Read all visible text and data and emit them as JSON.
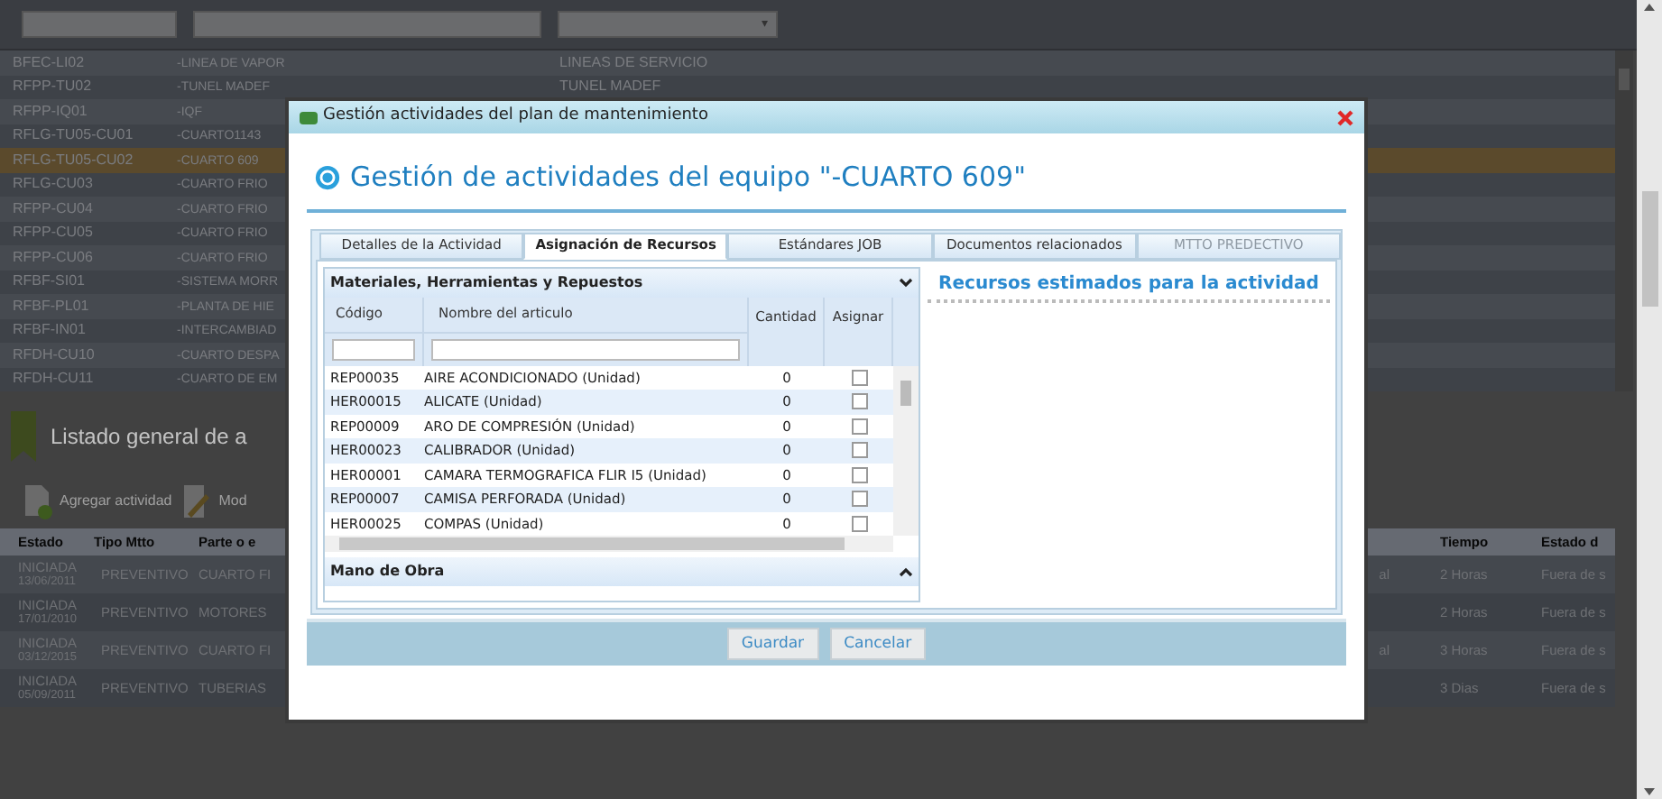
{
  "equipment_list": {
    "type_filter_caret": "▾",
    "rows": [
      {
        "code": "BFEC-LI02",
        "name": "-LINEA DE VAPOR",
        "type": "LINEAS DE SERVICIO",
        "selected": false
      },
      {
        "code": "RFPP-TU02",
        "name": "-TUNEL MADEF",
        "type": "TUNEL MADEF",
        "selected": false
      },
      {
        "code": "RFPP-IQ01",
        "name": "-IQF",
        "selected": false
      },
      {
        "code": "RFLG-TU05-CU01",
        "name": "-CUARTO1143",
        "selected": false
      },
      {
        "code": "RFLG-TU05-CU02",
        "name": "-CUARTO 609",
        "selected": true
      },
      {
        "code": "RFLG-CU03",
        "name": "-CUARTO FRIO",
        "selected": false
      },
      {
        "code": "RFPP-CU04",
        "name": "-CUARTO FRIO",
        "selected": false
      },
      {
        "code": "RFPP-CU05",
        "name": "-CUARTO FRIO",
        "selected": false
      },
      {
        "code": "RFPP-CU06",
        "name": "-CUARTO FRIO",
        "selected": false
      },
      {
        "code": "RFBF-SI01",
        "name": "-SISTEMA MORR",
        "selected": false
      },
      {
        "code": "RFBF-PL01",
        "name": "-PLANTA DE HIE",
        "selected": false
      },
      {
        "code": "RFBF-IN01",
        "name": "-INTERCAMBIAD",
        "selected": false
      },
      {
        "code": "RFDH-CU10",
        "name": "-CUARTO DESPA",
        "selected": false
      },
      {
        "code": "RFDH-CU11",
        "name": "-CUARTO DE EM",
        "selected": false
      }
    ]
  },
  "activities": {
    "title": "Listado general de a",
    "toolbar": [
      "Agregar actividad",
      "Mod"
    ],
    "columns_left": [
      "Estado",
      "Tipo Mtto",
      "Parte o e"
    ],
    "columns_right": [
      "Tiempo",
      "Estado d"
    ],
    "rows": [
      {
        "status": "INICIADA",
        "date": "13/06/2011",
        "type": "PREVENTIVO",
        "part": "CUARTO FI",
        "fragment": "al",
        "time": "2 Horas",
        "state": "Fuera de s"
      },
      {
        "status": "INICIADA",
        "date": "17/01/2010",
        "type": "PREVENTIVO",
        "part": "MOTORES",
        "time": "2 Horas",
        "state": "Fuera de s"
      },
      {
        "status": "INICIADA",
        "date": "03/12/2015",
        "type": "PREVENTIVO",
        "part": "CUARTO FI",
        "fragment": "al",
        "time": "3 Horas",
        "state": "Fuera de s"
      },
      {
        "status": "INICIADA",
        "date": "05/09/2011",
        "type": "PREVENTIVO",
        "part": "TUBERIAS",
        "time": "3 Dias",
        "state": "Fuera de s"
      }
    ]
  },
  "dialog": {
    "title": "Gestión actividades del plan de mantenimiento",
    "heading": "Gestión de actividades del equipo \"-CUARTO 609\"",
    "tabs": [
      {
        "label": "Detalles de la Actividad",
        "selected": false,
        "disabled": false
      },
      {
        "label": "Asignación de Recursos",
        "selected": true,
        "disabled": false
      },
      {
        "label": "Estándares JOB",
        "selected": false,
        "disabled": false
      },
      {
        "label": "Documentos relacionados",
        "selected": false,
        "disabled": false
      },
      {
        "label": "MTTO PREDECTIVO",
        "selected": false,
        "disabled": true
      }
    ],
    "sections": [
      {
        "title": "Materiales, Herramientas y Repuestos",
        "expanded": true
      },
      {
        "title": "Mano de Obra",
        "expanded": false
      }
    ],
    "grid": {
      "columns": [
        "Código",
        "Nombre del articulo",
        "Cantidad",
        "Asignar"
      ],
      "rows": [
        {
          "code": "REP00035",
          "name": "AIRE ACONDICIONADO (Unidad)",
          "qty": "0",
          "checked": false
        },
        {
          "code": "HER00015",
          "name": "ALICATE (Unidad)",
          "qty": "0",
          "checked": false
        },
        {
          "code": "REP00009",
          "name": "ARO DE COMPRESIÓN (Unidad)",
          "qty": "0",
          "checked": false
        },
        {
          "code": "HER00023",
          "name": "CALIBRADOR (Unidad)",
          "qty": "0",
          "checked": false
        },
        {
          "code": "HER00001",
          "name": "CAMARA TERMOGRAFICA FLIR I5 (Unidad)",
          "qty": "0",
          "checked": false
        },
        {
          "code": "REP00007",
          "name": "CAMISA PERFORADA (Unidad)",
          "qty": "0",
          "checked": false
        },
        {
          "code": "HER00025",
          "name": "COMPAS (Unidad)",
          "qty": "0",
          "checked": false
        }
      ]
    },
    "resources_title": "Recursos estimados para la actividad",
    "buttons": [
      "Guardar",
      "Cancelar"
    ]
  }
}
